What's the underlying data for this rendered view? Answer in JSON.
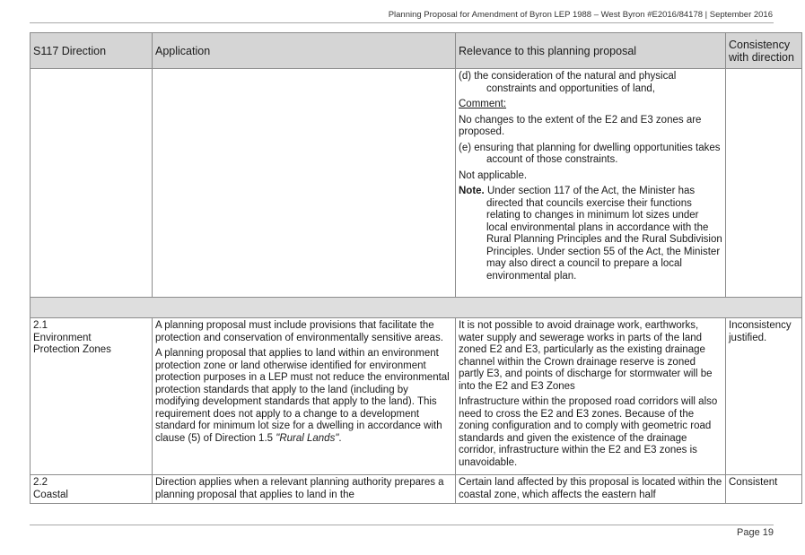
{
  "header": {
    "running_title": "Planning Proposal for Amendment of Byron LEP 1988 – West Byron #E2016/84178 | September  2016"
  },
  "table": {
    "columns": [
      "S117 Direction",
      "Application",
      "Relevance to this planning proposal",
      "Consistency with direction"
    ],
    "row_cont": {
      "item_d": "(d)  the consideration of the natural and physical constraints and opportunities of land,",
      "comment_label": "Comment:",
      "comment_text": "No changes to the extent of the E2 and E3 zones are proposed.",
      "item_e": "(e)  ensuring that planning for dwelling opportunities takes account of those constraints.",
      "not_applicable": "Not applicable.",
      "note_label": "Note.",
      "note_text": " Under section 117 of the Act, the Minister has directed that councils exercise their functions relating to changes in minimum lot sizes under local environmental plans in accordance with the Rural Planning Principles and the Rural Subdivision Principles. Under section 55 of the Act, the Minister may also direct a council to prepare a local environmental plan."
    },
    "row_21": {
      "number": "2.1",
      "title": "Environment Protection Zones",
      "application_p1": "A planning proposal must include provisions that facilitate the protection and conservation of environmentally sensitive areas.",
      "application_p2": "A planning proposal that applies to land within an environment protection zone or land otherwise identified for environment protection purposes in a LEP must not reduce the environmental protection standards that apply to the land (including by modifying development standards that apply to the land).  This requirement does not apply to a change to a development standard for minimum lot size for a dwelling in accordance with clause (5) of Direction 1.5 ",
      "application_p2_italic": "\"Rural Lands\"",
      "application_p2_end": ".",
      "relevance_p1": "It is not possible to avoid drainage work, earthworks, water supply and sewerage works in parts of the land zoned E2 and E3, particularly as the existing drainage channel within the Crown drainage reserve is zoned partly E3, and points of discharge for stormwater will be into the E2 and E3 Zones",
      "relevance_p2": "Infrastructure within the proposed road corridors will also need to cross the E2 and E3 zones. Because of the zoning configuration and to comply with geometric road standards and given the existence of the drainage corridor, infrastructure within the E2 and E3 zones is unavoidable.",
      "consistency": "Inconsistency justified."
    },
    "row_22": {
      "number": "2.2",
      "title": "Coastal",
      "application": "Direction applies when a relevant planning authority prepares a planning proposal that applies to land in the",
      "relevance": "Certain land affected by this proposal is located within the coastal zone, which affects the eastern half",
      "consistency": "Consistent"
    }
  },
  "footer": {
    "page_label": "Page 19"
  }
}
